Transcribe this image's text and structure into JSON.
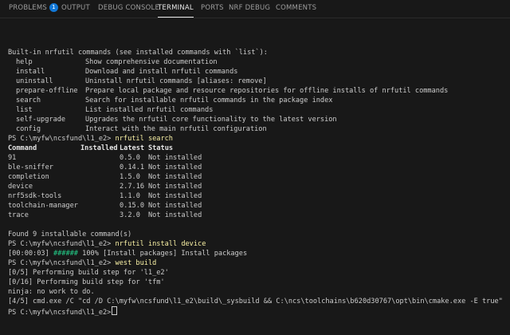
{
  "panel_tabs": [
    {
      "label": "PROBLEMS",
      "badge": "1"
    },
    {
      "label": "OUTPUT"
    },
    {
      "label": "DEBUG CONSOLE"
    },
    {
      "label": "TERMINAL"
    },
    {
      "label": "PORTS"
    },
    {
      "label": "NRF DEBUG"
    },
    {
      "label": "COMMENTS"
    }
  ],
  "active_tab": "TERMINAL",
  "terminal": {
    "builtin_header": "Built-in nrfutil commands (see installed commands with `list`):",
    "builtin": [
      {
        "name": "help",
        "desc": "Show comprehensive documentation"
      },
      {
        "name": "install",
        "desc": "Download and install nrfutil commands"
      },
      {
        "name": "uninstall",
        "desc": "Uninstall nrfutil commands [aliases: remove]"
      },
      {
        "name": "prepare-offline",
        "desc": "Prepare local package and resource repositories for offline installs of nrfutil commands"
      },
      {
        "name": "search",
        "desc": "Search for installable nrfutil commands in the package index"
      },
      {
        "name": "list",
        "desc": "List installed nrfutil commands"
      },
      {
        "name": "self-upgrade",
        "desc": "Upgrades the nrfutil core functionality to the latest version"
      },
      {
        "name": "config",
        "desc": "Interact with the main nrfutil configuration"
      }
    ],
    "prompt": "PS C:\\myfw\\ncsfund\\l1_e2>",
    "cmd_search": "nrfutil search",
    "table_headers": {
      "command": "Command",
      "installed": "Installed",
      "latest": "Latest",
      "status": "Status"
    },
    "search_rows": [
      {
        "command": "91",
        "installed": "",
        "latest": "0.5.0",
        "status": "Not installed"
      },
      {
        "command": "ble-sniffer",
        "installed": "",
        "latest": "0.14.1",
        "status": "Not installed"
      },
      {
        "command": "completion",
        "installed": "",
        "latest": "1.5.0",
        "status": "Not installed"
      },
      {
        "command": "device",
        "installed": "",
        "latest": "2.7.16",
        "status": "Not installed"
      },
      {
        "command": "nrf5sdk-tools",
        "installed": "",
        "latest": "1.1.0",
        "status": "Not installed"
      },
      {
        "command": "toolchain-manager",
        "installed": "",
        "latest": "0.15.0",
        "status": "Not installed"
      },
      {
        "command": "trace",
        "installed": "",
        "latest": "3.2.0",
        "status": "Not installed"
      }
    ],
    "found_text": "Found 9 installable command(s)",
    "cmd_install": "nrfutil install device",
    "install_time": "[00:00:03]",
    "install_bar": "######",
    "install_rest": "100% [Install packages] Install packages",
    "cmd_build": "west build",
    "build_lines": [
      "[0/5] Performing build step for 'l1_e2'",
      "[0/16] Performing build step for 'tfm'",
      "ninja: no work to do.",
      "[4/5] cmd.exe /C \"cd /D C:\\myfw\\ncsfund\\l1_e2\\build\\_sysbuild && C:\\ncs\\toolchains\\b620d30767\\opt\\bin\\cmake.exe -E true\""
    ]
  },
  "colors": {
    "background": "#181818",
    "text": "#cccccc",
    "command_highlight": "#f9f1a5",
    "progress_green": "#23d18b",
    "badge_blue": "#1177d6"
  }
}
